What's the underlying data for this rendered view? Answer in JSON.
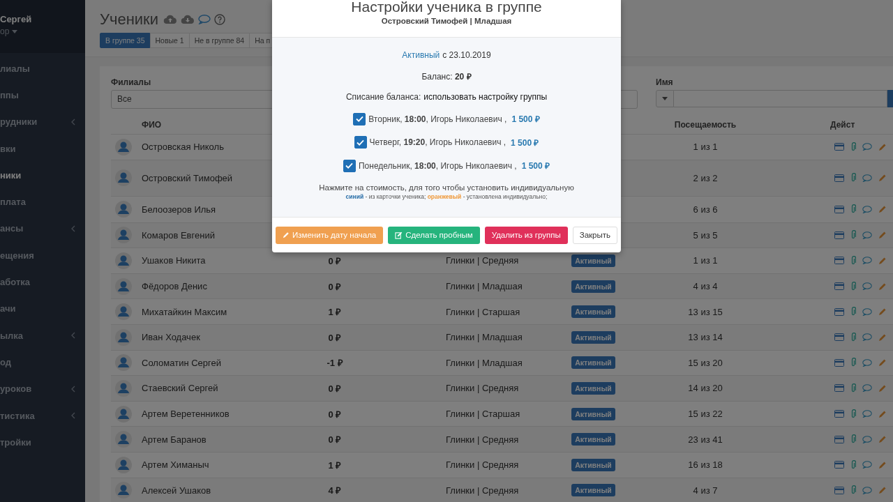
{
  "sidebar": {
    "user": {
      "name": "Сергей",
      "role": "ор"
    },
    "items": [
      {
        "label": "лиалы",
        "selected": false,
        "submenu": false
      },
      {
        "label": "ппы",
        "selected": false,
        "submenu": false
      },
      {
        "label": "рудники",
        "selected": false,
        "submenu": true
      },
      {
        "label": "вки",
        "selected": false,
        "submenu": false
      },
      {
        "label": "ники",
        "selected": true,
        "submenu": false
      },
      {
        "label": "плата",
        "selected": false,
        "submenu": false
      },
      {
        "label": "ансы",
        "selected": false,
        "submenu": true
      },
      {
        "label": "ещения",
        "selected": false,
        "submenu": false
      },
      {
        "label": "аботка",
        "selected": false,
        "submenu": false
      },
      {
        "label": "ачи",
        "selected": false,
        "submenu": false
      },
      {
        "label": "ылка",
        "selected": false,
        "submenu": true
      },
      {
        "label": "од",
        "selected": false,
        "submenu": false
      },
      {
        "label": "уроков",
        "selected": false,
        "submenu": true
      },
      {
        "label": "тистика",
        "selected": false,
        "submenu": true
      },
      {
        "label": "тройки",
        "selected": false,
        "submenu": false
      }
    ]
  },
  "page": {
    "title": "Ученики",
    "tabs": [
      {
        "label": "В группе 35",
        "selected": true
      },
      {
        "label": "Новые 1",
        "selected": false
      },
      {
        "label": "Не в группе 84",
        "selected": false
      },
      {
        "label": "На п",
        "selected": false
      }
    ]
  },
  "filters": [
    {
      "kind": "select",
      "label": "Филиалы",
      "value": "Все"
    },
    {
      "kind": "search",
      "label": "Имя"
    }
  ],
  "table": {
    "columns": {
      "name": "ФИО",
      "attendance": "Посещаемость",
      "actions": "Дейст"
    },
    "rows": [
      {
        "name": "Островская Николь",
        "attendance": "1 из 1"
      },
      {
        "name": "Островский Тимофей",
        "attendance": "2 из 2"
      },
      {
        "name": "Белоозеров Илья",
        "attendance": "6 из 6"
      },
      {
        "name": "Комаров Евгений",
        "attendance": "5 из 5"
      },
      {
        "name": "Ушаков Никита",
        "balance": "0 ₽",
        "group": "Глинки | Средняя",
        "status": "Активный",
        "attendance": "1 из 1"
      },
      {
        "name": "Фёдоров Денис",
        "balance": "0 ₽",
        "group": "Глинки | Младшая",
        "status": "Активный",
        "attendance": "4 из 4"
      },
      {
        "name": "Михатайкин Максим",
        "balance": "1 ₽",
        "group": "Глинки | Старшая",
        "status": "Активный",
        "attendance": "13 из 15"
      },
      {
        "name": "Иван Ходачек",
        "balance": "0 ₽",
        "group": "Глинки | Младшая",
        "status": "Активный",
        "attendance": "13 из 14"
      },
      {
        "name": "Соломатин Сергей",
        "balance": "-1 ₽",
        "group": "Глинки | Младшая",
        "status": "Активный",
        "attendance": "15 из 20"
      },
      {
        "name": "Стаевский Сергей",
        "balance": "0 ₽",
        "group": "Глинки | Средняя",
        "status": "Активный",
        "attendance": "14 из 20"
      },
      {
        "name": "Артем Веретенников",
        "balance": "0 ₽",
        "group": "Глинки | Старшая",
        "status": "Активный",
        "attendance": "15 из 22"
      },
      {
        "name": "Артем Баранов",
        "balance": "0 ₽",
        "group": "Глинки | Средняя",
        "status": "Активный",
        "attendance": "23 из 41"
      },
      {
        "name": "Артем Химаныч",
        "balance": "1 ₽",
        "group": "Глинки | Средняя",
        "status": "Активный",
        "attendance": "16 из 18"
      },
      {
        "name": "Алексей Ушаков",
        "balance": "4 ₽",
        "group": "Глинки | Средняя",
        "status": "Активный",
        "attendance": "4 из 7"
      }
    ]
  },
  "modal": {
    "title": "Настройки ученика в группе",
    "subtitle": "Островский Тимофей | Младшая",
    "status": {
      "label": "Активный",
      "since": "с 23.10.2019"
    },
    "balance": "Баланс: **20 ₽**",
    "writeoff": {
      "label": "Списание баланса:",
      "value": "использовать настройку группы"
    },
    "lessons": [
      {
        "text": "Вторник, **18:00**, Игорь Николаевич ,",
        "price": "1 500 ₽",
        "checked": true,
        "individual": false
      },
      {
        "text": "Четверг, **19:20**, Игорь Николаевич ,",
        "price": "1 500 ₽",
        "checked": true,
        "individual": false
      },
      {
        "text": "Понедельник, **18:00**, Игорь Николаевич ,",
        "price": "1 500 ₽",
        "checked": true,
        "individual": false
      }
    ],
    "hint": "Нажмите на стоимость, для того чтобы установить индивидуальную",
    "legend": "**синий** - из карточки ученика; **оранжевый** - установлена индивидуально;",
    "buttons": [
      {
        "label": "Изменить дату начала",
        "kind": "warning"
      },
      {
        "label": "Сделать пробным",
        "kind": "success"
      },
      {
        "label": "Удалить из группы",
        "kind": "danger"
      },
      {
        "label": "Закрыть",
        "kind": "default"
      }
    ]
  }
}
